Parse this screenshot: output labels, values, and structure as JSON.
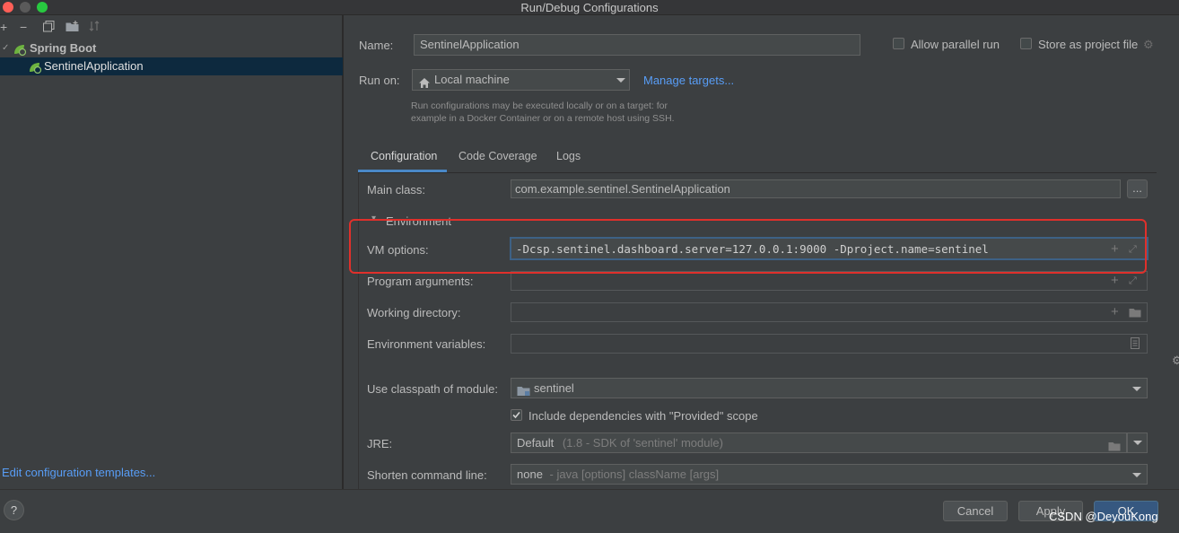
{
  "window": {
    "title": "Run/Debug Configurations",
    "controls": {
      "close_color": "#ff5f57",
      "minimize_color": "#5a5a5a",
      "zoom_color": "#28c940"
    }
  },
  "left_toolbar": {
    "icons": [
      "add-icon",
      "remove-icon",
      "copy-icon",
      "folder-icon",
      "sort-icon"
    ],
    "add": "+",
    "remove": "−"
  },
  "tree": {
    "group": {
      "label": "Spring Boot",
      "icon": "spring-boot-icon"
    },
    "items": [
      {
        "label": "SentinelApplication",
        "icon": "spring-boot-icon",
        "selected": true
      }
    ]
  },
  "edit_templates_link": "Edit configuration templates...",
  "form": {
    "name_label": "Name:",
    "name_value": "SentinelApplication",
    "allow_parallel_label": "Allow parallel run",
    "store_project_label": "Store as project file",
    "run_on_label": "Run on:",
    "run_on_value": "Local machine",
    "manage_targets": "Manage targets...",
    "hint_line1": "Run configurations may be executed locally or on a target: for",
    "hint_line2": "example in a Docker Container or on a remote host using SSH."
  },
  "tabs": [
    {
      "label": "Configuration",
      "active": true
    },
    {
      "label": "Code Coverage",
      "active": false
    },
    {
      "label": "Logs",
      "active": false
    }
  ],
  "config": {
    "main_class_label": "Main class:",
    "main_class_value": "com.example.sentinel.SentinelApplication",
    "browse_label": "...",
    "environment_label": "Environment",
    "vm_options_label": "VM options:",
    "vm_options_value": "-Dcsp.sentinel.dashboard.server=127.0.0.1:9000 -Dproject.name=sentinel",
    "program_args_label": "Program arguments:",
    "working_dir_label": "Working directory:",
    "env_vars_label": "Environment variables:",
    "classpath_label": "Use classpath of module:",
    "classpath_value": "sentinel",
    "include_deps_label": "Include dependencies with \"Provided\" scope",
    "include_deps_checked": true,
    "jre_label": "JRE:",
    "jre_value": "Default",
    "jre_detail": "(1.8 - SDK of 'sentinel' module)",
    "shorten_label": "Shorten command line:",
    "shorten_value": "none",
    "shorten_detail": "- java [options] className [args]"
  },
  "buttons": {
    "help": "?",
    "cancel": "Cancel",
    "apply": "Apply",
    "ok": "OK"
  },
  "watermark": "CSDN @DeyouKong",
  "colors": {
    "accent": "#4a88c7",
    "link": "#589df6",
    "highlight_box": "#e0302b",
    "selection": "#0d293e"
  }
}
